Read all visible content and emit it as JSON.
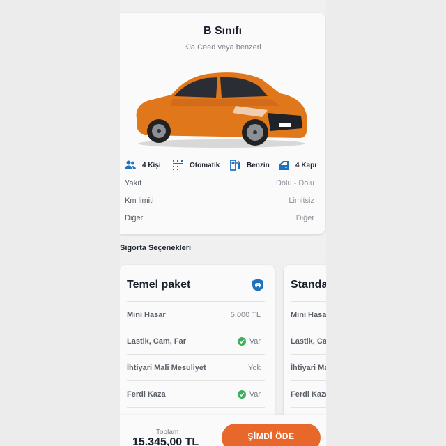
{
  "car": {
    "title": "B Sınıfı",
    "subtitle": "Kia Ceed veya benzeri",
    "features": [
      {
        "icon": "people-icon",
        "label": "4 Kişi"
      },
      {
        "icon": "gear-shift-icon",
        "label": "Otomatik"
      },
      {
        "icon": "fuel-pump-icon",
        "label": "Benzin"
      },
      {
        "icon": "car-door-icon",
        "label": "4 Kapı"
      }
    ],
    "specs": [
      {
        "label": "Yakıt",
        "value": "Dolu - Dolu"
      },
      {
        "label": "Km limiti",
        "value": "Limitsiz"
      },
      {
        "label": "Diğer",
        "value": "Diğer"
      }
    ],
    "accent_color": "#1e73be",
    "car_color": "#e0771a"
  },
  "insurance": {
    "section_title": "Sigorta Seçenekleri",
    "packages": [
      {
        "title": "Temel paket",
        "icon": "shield-car-icon",
        "rows": [
          {
            "label": "Mini Hasar",
            "value": "5.000 TL"
          },
          {
            "label": "Lastik, Cam, Far",
            "value": "Var",
            "check": true
          },
          {
            "label": "İhtiyari Mali Mesuliyet",
            "value": "Yok"
          },
          {
            "label": "Ferdi Kaza",
            "value": "Var",
            "check": true
          }
        ]
      },
      {
        "title": "Standart paket",
        "rows": [
          {
            "label": "Mini Hasar"
          },
          {
            "label": "Lastik, Cam, Far"
          },
          {
            "label": "İhtiyari Mali Mesuliyet"
          },
          {
            "label": "Ferdi Kaza"
          }
        ]
      }
    ],
    "check_color": "#3fae5a"
  },
  "footer": {
    "total_label": "Toplam",
    "total_value": "15.345,00 TL",
    "pay_label": "ŞİMDİ ÖDE",
    "button_color": "#e8682c"
  }
}
